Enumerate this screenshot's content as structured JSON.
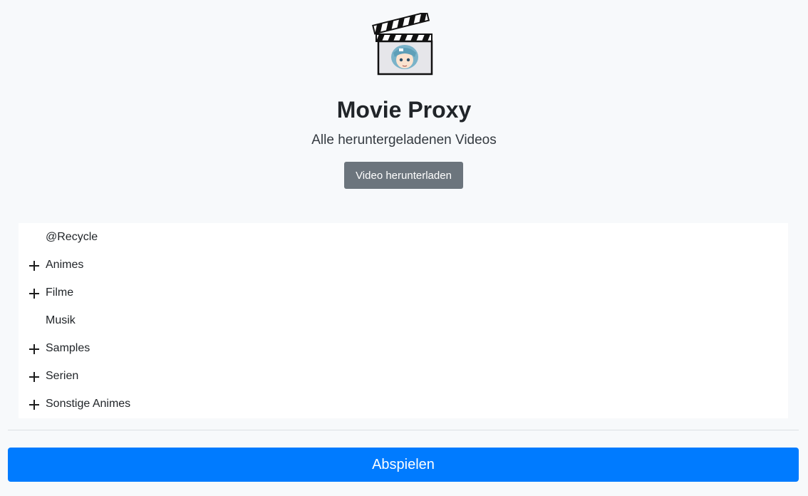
{
  "header": {
    "title": "Movie Proxy",
    "subtitle": "Alle heruntergeladenen Videos",
    "download_button": "Video herunterladen",
    "logo_icon": "clapperboard-anime-logo"
  },
  "tree": {
    "items": [
      {
        "label": "@Recycle",
        "expandable": false
      },
      {
        "label": "Animes",
        "expandable": true
      },
      {
        "label": "Filme",
        "expandable": true
      },
      {
        "label": "Musik",
        "expandable": false
      },
      {
        "label": "Samples",
        "expandable": true
      },
      {
        "label": "Serien",
        "expandable": true
      },
      {
        "label": "Sonstige Animes",
        "expandable": true
      }
    ],
    "expand_icon": "plus-icon"
  },
  "footer": {
    "play_button": "Abspielen"
  },
  "colors": {
    "background": "#f7f9fb",
    "primary": "#007bff",
    "secondary": "#6c757d"
  }
}
